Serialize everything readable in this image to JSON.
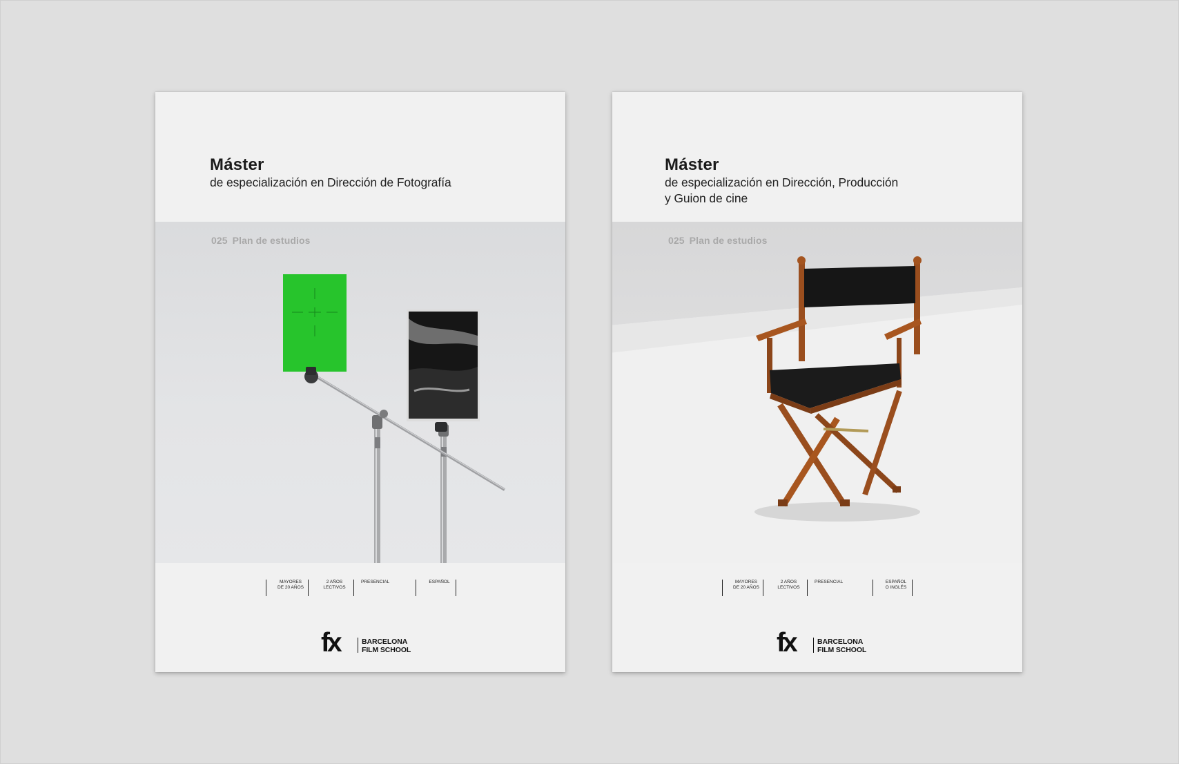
{
  "brochures": [
    {
      "title": "Máster",
      "subtitle_line1": "de especialización en Dirección de Fotografía",
      "subtitle_line2": "",
      "plan_code": "025",
      "plan_label": "Plan de estudios",
      "tags": [
        {
          "line1": "MAYORES",
          "line2": "DE 20 AÑOS"
        },
        {
          "line1": "2 AÑOS",
          "line2": "LECTIVOS"
        },
        {
          "line1": "PRESENCIAL",
          "line2": ""
        },
        {
          "line1": "ESPAÑOL",
          "line2": ""
        }
      ],
      "logo_mark": "fx",
      "logo_line1": "BARCELONA",
      "logo_line2": "FILM SCHOOL",
      "photo": "grip-stands-with-green-card-and-photo",
      "accent_color": "#27c42c"
    },
    {
      "title": "Máster",
      "subtitle_line1": "de especialización en Dirección, Producción",
      "subtitle_line2": "y Guion de cine",
      "plan_code": "025",
      "plan_label": "Plan de estudios",
      "tags": [
        {
          "line1": "MAYORES",
          "line2": "DE 20 AÑOS"
        },
        {
          "line1": "2 AÑOS",
          "line2": "LECTIVOS"
        },
        {
          "line1": "PRESENCIAL",
          "line2": ""
        },
        {
          "line1": "ESPAÑOL",
          "line2": "O INGLÉS"
        }
      ],
      "logo_mark": "fx",
      "logo_line1": "BARCELONA",
      "logo_line2": "FILM SCHOOL",
      "photo": "director-chair",
      "accent_color": "#1c1c1c"
    }
  ]
}
